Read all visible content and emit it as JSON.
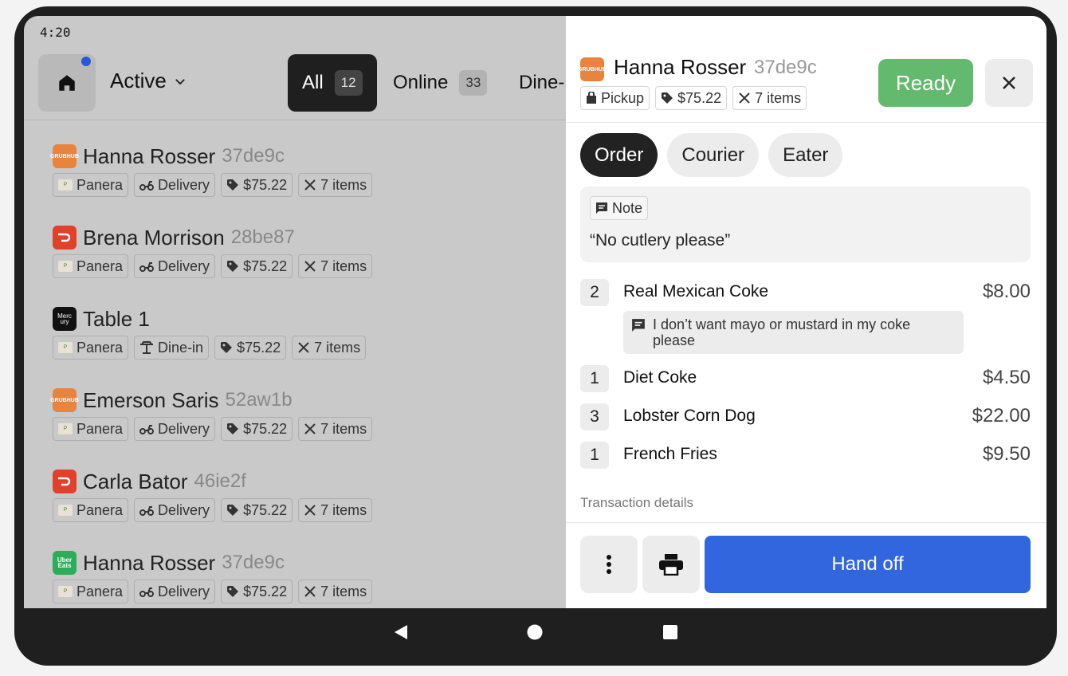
{
  "status_bar": {
    "time": "4:20"
  },
  "header": {
    "view_label": "Active",
    "filters": [
      {
        "label": "All",
        "count": "12",
        "selected": true
      },
      {
        "label": "Online",
        "count": "33",
        "selected": false
      },
      {
        "label": "Dine-",
        "count": "",
        "selected": false
      }
    ]
  },
  "orders": [
    {
      "source": "GRUBHUB",
      "name": "Hanna Rosser",
      "id": "37de9c",
      "brand": "Panera",
      "mode": "Delivery",
      "total": "$75.22",
      "items": "7 items"
    },
    {
      "source": "DOORDASH",
      "name": "Brena Morrison",
      "id": "28be87",
      "brand": "Panera",
      "mode": "Delivery",
      "total": "$75.22",
      "items": "7 items"
    },
    {
      "source": "Merc ury",
      "name": "Table 1",
      "id": "",
      "brand": "Panera",
      "mode": "Dine-in",
      "total": "$75.22",
      "items": "7 items"
    },
    {
      "source": "GRUBHUB",
      "name": "Emerson Saris",
      "id": "52aw1b",
      "brand": "Panera",
      "mode": "Delivery",
      "total": "$75.22",
      "items": "7 items"
    },
    {
      "source": "DOORDASH",
      "name": "Carla Bator",
      "id": "46ie2f",
      "brand": "Panera",
      "mode": "Delivery",
      "total": "$75.22",
      "items": "7 items"
    },
    {
      "source": "Uber Eats",
      "name": "Hanna Rosser",
      "id": "37de9c",
      "brand": "Panera",
      "mode": "Delivery",
      "total": "$75.22",
      "items": "7 items"
    }
  ],
  "detail": {
    "source_logo": "GRUBHUB",
    "name": "Hanna Rosser",
    "id": "37de9c",
    "mode": "Pickup",
    "total": "$75.22",
    "items_count": "7 items",
    "ready_label": "Ready",
    "tabs": [
      "Order",
      "Courier",
      "Eater"
    ],
    "note_label": "Note",
    "note_text": "“No cutlery please”",
    "items": [
      {
        "qty": "2",
        "name": "Real Mexican Coke",
        "price": "$8.00"
      },
      {
        "qty": "1",
        "name": "Diet Coke",
        "price": "$4.50"
      },
      {
        "qty": "3",
        "name": "Lobster Corn Dog",
        "price": "$22.00"
      },
      {
        "qty": "1",
        "name": "French Fries",
        "price": "$9.50"
      }
    ],
    "item_modifier": "I don’t want mayo or mustard in my coke please",
    "transaction_label": "Transaction details",
    "handoff_label": "Hand off"
  },
  "colors": {
    "ready": "#63b96d",
    "handoff": "#3166de",
    "grubhub": "#e8843d",
    "doordash": "#e1402a",
    "uber_eats": "#2bad59",
    "notification_dot": "#2858d6"
  },
  "icons": [
    "home-icon",
    "chevron-down-icon",
    "close-icon",
    "bag-icon",
    "tag-icon",
    "utensils-icon",
    "scooter-icon",
    "table-icon",
    "message-icon",
    "more-vertical-icon",
    "printer-icon",
    "back-icon",
    "home-circle-icon",
    "recents-icon"
  ]
}
